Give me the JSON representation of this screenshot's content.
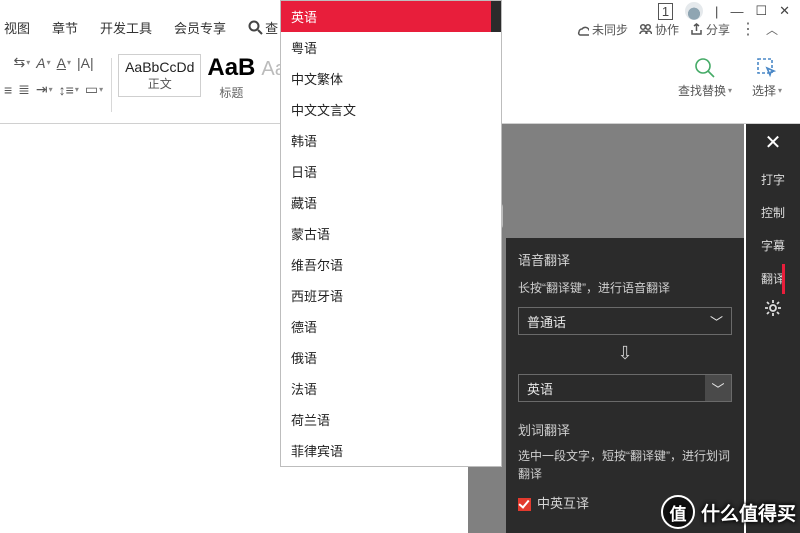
{
  "window": {
    "badge": "1",
    "min": "—",
    "max": "☐",
    "close": "✕"
  },
  "collab": {
    "sync": "未同步",
    "coop": "协作",
    "share": "分享"
  },
  "tabs": {
    "view": "视图",
    "chapter": "章节",
    "dev": "开发工具",
    "vip": "会员专享",
    "search": "查"
  },
  "ribbon": {
    "style_normal_sample": "AaBbCcDd",
    "style_normal_label": "正文",
    "heading1_sample": "AaB",
    "heading1_label": "标题",
    "faint_sample": "AaBbC",
    "find_replace": "查找替换",
    "select": "选择"
  },
  "languages": {
    "selected": "英语",
    "items": [
      "英语",
      "粤语",
      "中文繁体",
      "中文文言文",
      "韩语",
      "日语",
      "藏语",
      "蒙古语",
      "维吾尔语",
      "西班牙语",
      "德语",
      "俄语",
      "法语",
      "荷兰语",
      "菲律宾语"
    ]
  },
  "panel": {
    "voice_title": "语音翻译",
    "voice_hint": "长按“翻译键”，进行语音翻译",
    "src_lang": "普通话",
    "dst_lang": "英语",
    "sel_title": "划词翻译",
    "sel_hint": "选中一段文字，短按“翻译键”，进行划词翻译",
    "bi_label": "中英互译"
  },
  "sidebar": {
    "type": "打字",
    "control": "控制",
    "subtitle": "字幕",
    "translate": "翻译"
  },
  "watermark": {
    "text": "什么值得买",
    "mark": "值"
  }
}
